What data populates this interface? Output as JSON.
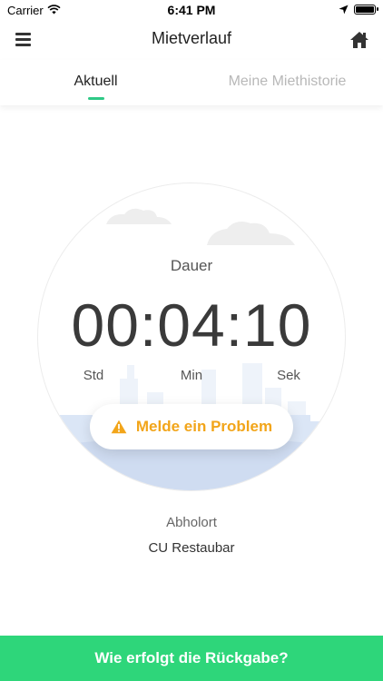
{
  "status_bar": {
    "carrier": "Carrier",
    "time": "6:41 PM"
  },
  "nav": {
    "title": "Mietverlauf",
    "left_icon": "menu-icon",
    "right_icon": "home-icon"
  },
  "tabs": [
    {
      "label": "Aktuell",
      "active": true
    },
    {
      "label": "Meine Miethistorie",
      "active": false
    }
  ],
  "timer": {
    "label": "Dauer",
    "value": "00:04:10",
    "units": {
      "hours": "Std",
      "minutes": "Min",
      "seconds": "Sek"
    }
  },
  "report_button": {
    "label": "Melde ein Problem",
    "icon": "warning-icon",
    "color": "#f2a51a"
  },
  "pickup": {
    "label": "Abholort",
    "value": "CU Restaubar"
  },
  "bottom_button": {
    "label": "Wie erfolgt die Rückgabe?",
    "color": "#2ed67a"
  },
  "colors": {
    "accent": "#2ec986",
    "inactive_tab": "#b8b8b8"
  }
}
